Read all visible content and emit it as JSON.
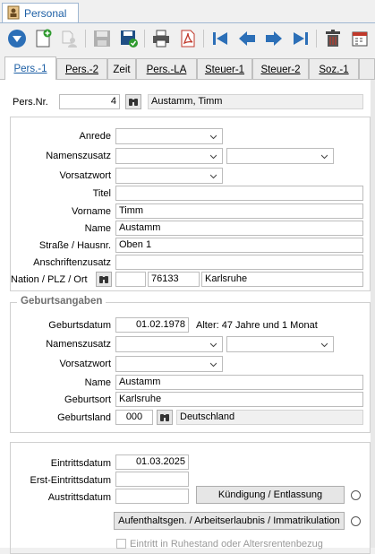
{
  "window": {
    "tab_label": "Personal"
  },
  "toolbar": {
    "icons": [
      "dropdown-icon",
      "new-record-icon",
      "copy-user-icon",
      "save-disabled-icon",
      "save-check-icon",
      "print-icon",
      "pdf-icon",
      "first-icon",
      "previous-icon",
      "next-icon",
      "last-icon",
      "delete-icon",
      "calendar-icon"
    ]
  },
  "tabs": [
    {
      "label": "Pers.-1"
    },
    {
      "label": "Pers.-2"
    },
    {
      "label": "Zeit"
    },
    {
      "label": "Pers.-LA"
    },
    {
      "label": "Steuer-1"
    },
    {
      "label": "Steuer-2"
    },
    {
      "label": "Soz.-1"
    }
  ],
  "header": {
    "persnr_label": "Pers.Nr.",
    "persnr_value": "4",
    "name_value": "Austamm, Timm"
  },
  "person": {
    "anrede_label": "Anrede",
    "namenszusatz_label": "Namenszusatz",
    "vorsatzwort_label": "Vorsatzwort",
    "titel_label": "Titel",
    "titel_value": "",
    "vorname_label": "Vorname",
    "vorname_value": "Timm",
    "name_label": "Name",
    "name_value": "Austamm",
    "strasse_label": "Straße / Hausnr.",
    "strasse_value": "Oben 1",
    "anschrift_label": "Anschriftenzusatz",
    "anschrift_value": "",
    "nation_label": "Nation / PLZ / Ort",
    "nation_value": "",
    "plz_value": "76133",
    "ort_value": "Karlsruhe"
  },
  "birth": {
    "title": "Geburtsangaben",
    "datum_label": "Geburtsdatum",
    "datum_value": "01.02.1978",
    "alter_text": "Alter: 47 Jahre und 1 Monat",
    "namenszusatz_label": "Namenszusatz",
    "vorsatzwort_label": "Vorsatzwort",
    "name_label": "Name",
    "name_value": "Austamm",
    "ort_label": "Geburtsort",
    "ort_value": "Karlsruhe",
    "land_label": "Geburtsland",
    "land_code": "000",
    "land_name": "Deutschland"
  },
  "employment": {
    "eintritt_label": "Eintrittsdatum",
    "eintritt_value": "01.03.2025",
    "erst_label": "Erst-Eintrittsdatum",
    "erst_value": "",
    "austritt_label": "Austrittsdatum",
    "austritt_value": "",
    "kuendigung_label": "Kündigung / Entlassung",
    "aufenthalt_label": "Aufenthaltsgen. / Arbeitserlaubnis / Immatrikulation",
    "ruhestand_label": "Eintritt in Ruhestand oder Altersrentenbezug"
  }
}
